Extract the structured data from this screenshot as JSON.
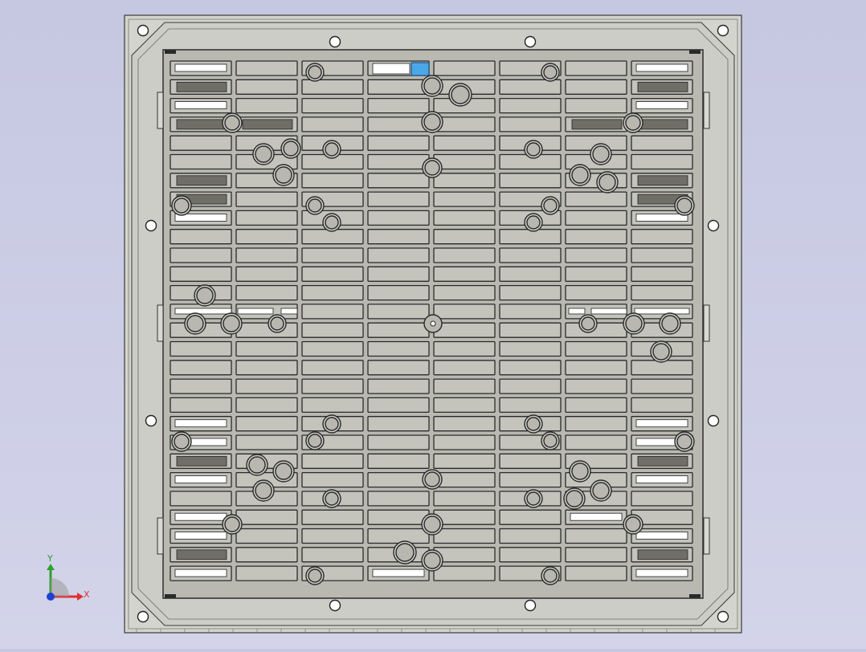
{
  "triad": {
    "x_label": "X",
    "y_label": "Y",
    "x_color": "#e03030",
    "y_color": "#30a030",
    "z_color": "#2040d0"
  },
  "colors": {
    "background": "#c9cae3",
    "panel_outer": "#d4d4ce",
    "panel_inner": "#cdcdc7",
    "frame_stroke": "#3a3a3a",
    "slot_fill": "#c4c4bd",
    "dark_slot": "#6f6f68",
    "highlight": "#4aa8e8",
    "hole_fill": "#ffffff",
    "boss_fill": "#b8b8b0"
  },
  "grid": {
    "rows": 28,
    "columns": 8
  }
}
